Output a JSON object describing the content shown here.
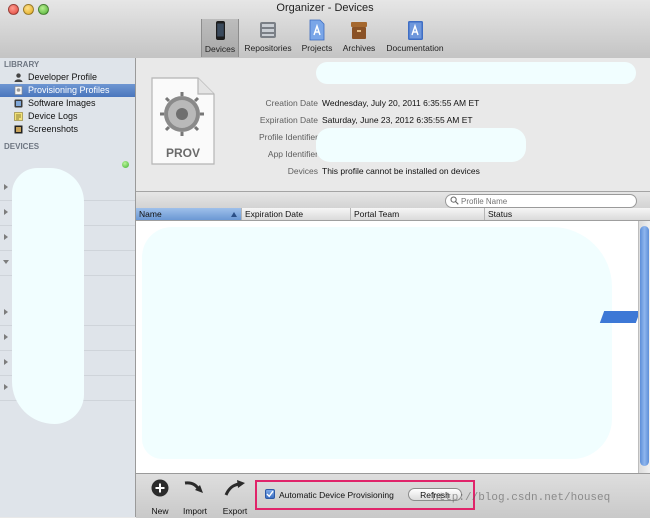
{
  "window": {
    "title": "Organizer - Devices"
  },
  "toolbar": {
    "items": [
      {
        "label": "Devices",
        "icon": "device-icon"
      },
      {
        "label": "Repositories",
        "icon": "repositories-icon"
      },
      {
        "label": "Projects",
        "icon": "projects-icon"
      },
      {
        "label": "Archives",
        "icon": "archives-icon"
      },
      {
        "label": "Documentation",
        "icon": "documentation-icon"
      }
    ],
    "selected": "Devices"
  },
  "sidebar": {
    "library_heading": "LIBRARY",
    "items": [
      {
        "label": "Developer Profile",
        "icon": "person-icon"
      },
      {
        "label": "Provisioning Profiles",
        "icon": "profile-icon"
      },
      {
        "label": "Software Images",
        "icon": "software-image-icon"
      },
      {
        "label": "Device Logs",
        "icon": "log-icon"
      },
      {
        "label": "Screenshots",
        "icon": "screenshot-icon"
      }
    ],
    "selected": "Provisioning Profiles",
    "devices_heading": "DEVICES"
  },
  "detail": {
    "icon_label": "PROV",
    "fields": [
      {
        "label": "Creation Date",
        "value": "Wednesday, July 20, 2011 6:35:55 AM ET"
      },
      {
        "label": "Expiration Date",
        "value": "Saturday, June 23, 2012 6:35:55 AM ET"
      },
      {
        "label": "Profile Identifier",
        "value": ""
      },
      {
        "label": "App Identifier",
        "value": ""
      },
      {
        "label": "Devices",
        "value": "This profile cannot be installed on devices"
      }
    ]
  },
  "search": {
    "placeholder": "Profile Name"
  },
  "table": {
    "columns": [
      "Name",
      "Expiration Date",
      "Portal Team",
      "Status"
    ],
    "sorted_column": "Name"
  },
  "bottom": {
    "buttons": [
      {
        "label": "New",
        "icon": "plus-circle-icon"
      },
      {
        "label": "Import",
        "icon": "import-arrow-icon"
      },
      {
        "label": "Export",
        "icon": "export-arrow-icon"
      }
    ],
    "auto_provisioning_label": "Automatic Device Provisioning",
    "auto_provisioning_checked": true,
    "refresh_label": "Refresh"
  },
  "watermark": "http://blog.csdn.net/houseq",
  "colors": {
    "selection": "#4a76bd",
    "highlight_box": "#e0246a",
    "status_online": "#3fb02f"
  }
}
